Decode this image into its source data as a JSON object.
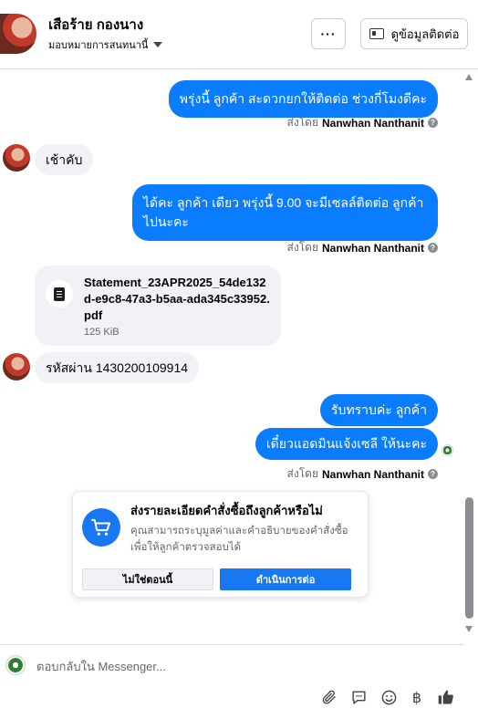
{
  "header": {
    "contact_name": "เสือร้าย กองนาง",
    "assign_label": "มอบหมายการสนทนานี้",
    "more_label": "···",
    "view_contact_label": "ดูข้อมูลติดต่อ"
  },
  "messages": {
    "out1": "พรุ่งนี้ ลูกค้า สะดวกยกให้ติดต่อ ช่วงกี่โมงดีคะ",
    "sent_by_prefix": "ส่งโดย",
    "sent_by_name": "Nanwhan Nanthanit",
    "in1": "เช้าคับ",
    "out2_line1": "ได้คะ ลูกค้า เดียว พรุ่งนี้ 9.00 จะมีเซลล์ติดต่อ ลูกค้า",
    "out2_line2": "ไปนะคะ",
    "file_name": "Statement_23APR2025_54de132d-e9c8-47a3-b5aa-ada345c33952.pdf",
    "file_size": "125 KiB",
    "in2": "รหัสผ่าน 1430200109914",
    "out3": "รับทราบค่ะ ลูกค้า",
    "out4": "เดี๋ยวแอดมินแจ้งเซลี ให้นะคะ"
  },
  "prompt": {
    "title": "ส่งรายละเอียดคำสั่งซื้อถึงลูกค้าหรือไม่",
    "description": "คุณสามารถระบุมูลค่าและคำอธิบายของคำสั่งซื้อเพื่อให้ลูกค้าตรวจสอบได้",
    "dismiss_label": "ไม่ใช่ตอนนี้",
    "continue_label": "ดำเนินการต่อ"
  },
  "composer": {
    "placeholder": "ตอบกลับใน Messenger...",
    "currency_symbol": "฿"
  },
  "colors": {
    "accent": "#0a7cff",
    "primary_button": "#1877f2",
    "incoming_bubble": "#f0f2f5"
  },
  "icons": [
    "more-icon",
    "contact-card-icon",
    "chevron-down-icon",
    "document-icon",
    "help-icon",
    "cart-icon",
    "attach-icon",
    "saved-reply-icon",
    "emoji-icon",
    "currency-icon",
    "like-icon"
  ]
}
